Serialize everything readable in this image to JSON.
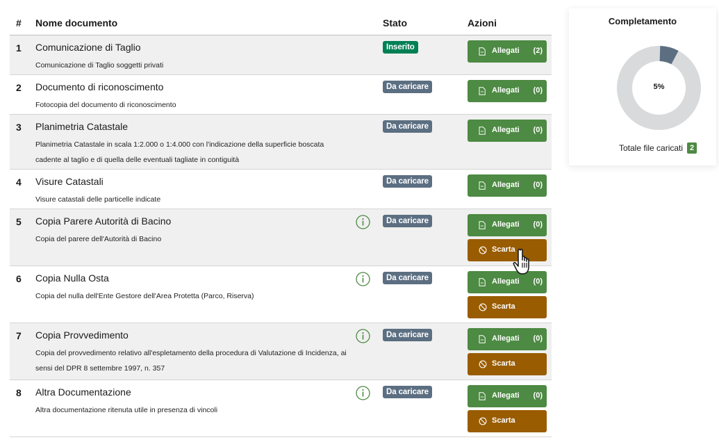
{
  "table": {
    "headers": {
      "num": "#",
      "name": "Nome documento",
      "stato": "Stato",
      "azioni": "Azioni"
    },
    "rows": [
      {
        "num": "1",
        "title": "Comunicazione di Taglio",
        "desc": "Comunicazione di Taglio soggetti privati",
        "status": "Inserito",
        "status_color": "#008055",
        "attach_label": "Allegati",
        "attach_count": "(2)",
        "discard_label": null,
        "has_info": false
      },
      {
        "num": "2",
        "title": "Documento di riconoscimento",
        "desc": "Fotocopia del documento di riconoscimento",
        "status": "Da caricare",
        "status_color": "#5c6f82",
        "attach_label": "Allegati",
        "attach_count": "(0)",
        "discard_label": null,
        "has_info": false
      },
      {
        "num": "3",
        "title": "Planimetria Catastale",
        "desc": "Planimetria Catastale in scala 1:2.000 o 1:4.000 con l'indicazione della superficie boscata cadente al taglio e di quella delle eventuali tagliate in contiguità",
        "status": "Da caricare",
        "status_color": "#5c6f82",
        "attach_label": "Allegati",
        "attach_count": "(0)",
        "discard_label": null,
        "has_info": false
      },
      {
        "num": "4",
        "title": "Visure Catastali",
        "desc": "Visure catastali delle particelle indicate",
        "status": "Da caricare",
        "status_color": "#5c6f82",
        "attach_label": "Allegati",
        "attach_count": "(0)",
        "discard_label": null,
        "has_info": false
      },
      {
        "num": "5",
        "title": "Copia Parere Autorità di Bacino",
        "desc": "Copia del parere dell'Autorità di Bacino",
        "status": "Da caricare",
        "status_color": "#5c6f82",
        "attach_label": "Allegati",
        "attach_count": "(0)",
        "discard_label": "Scarta",
        "has_info": true
      },
      {
        "num": "6",
        "title": "Copia Nulla Osta",
        "desc": "Copia del nulla dell'Ente Gestore dell'Area Protetta (Parco, Riserva)",
        "status": "Da caricare",
        "status_color": "#5c6f82",
        "attach_label": "Allegati",
        "attach_count": "(0)",
        "discard_label": "Scarta",
        "has_info": true
      },
      {
        "num": "7",
        "title": "Copia Provvedimento",
        "desc": "Copia del provvedimento relativo all'espletamento della procedura di Valutazione di Incidenza, ai sensi del DPR 8 settembre 1997, n. 357",
        "status": "Da caricare",
        "status_color": "#5c6f82",
        "attach_label": "Allegati",
        "attach_count": "(0)",
        "discard_label": "Scarta",
        "has_info": true
      },
      {
        "num": "8",
        "title": "Altra Documentazione",
        "desc": "Altra documentazione ritenuta utile in presenza di vincoli",
        "status": "Da caricare",
        "status_color": "#5c6f82",
        "attach_label": "Allegati",
        "attach_count": "(0)",
        "discard_label": "Scarta",
        "has_info": true
      }
    ]
  },
  "completion": {
    "title": "Completamento",
    "percent_label": "5%",
    "percent_value": 5,
    "ring_color": "#d9dadb",
    "fill_color": "#5c6f82",
    "total_label": "Totale file caricati",
    "total_count": "2"
  },
  "colors": {
    "allegati_button": "#4d8a43",
    "scarta_button": "#995c00",
    "row_shade": "#f0f0f0",
    "info_icon": "#4d8a43"
  }
}
